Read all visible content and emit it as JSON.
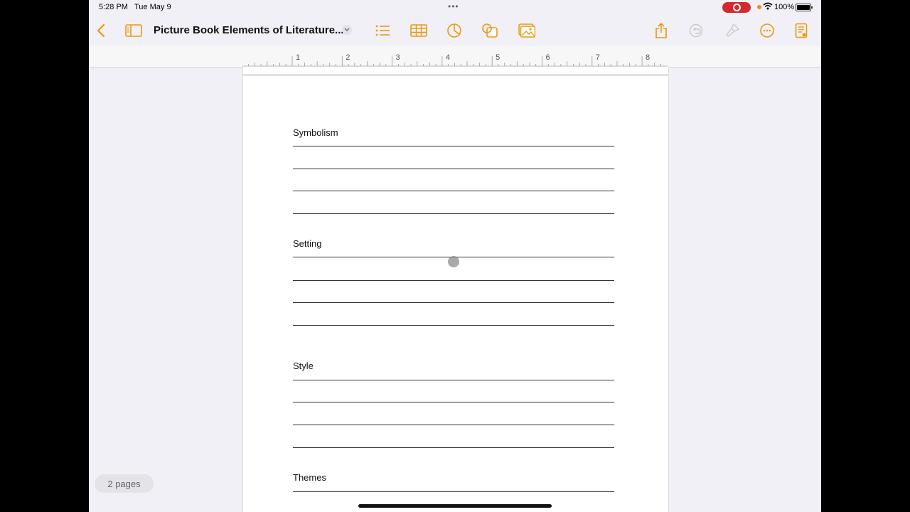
{
  "status_bar": {
    "time": "5:28 PM",
    "date": "Tue May 9",
    "battery": "100%"
  },
  "toolbar": {
    "document_title": "Picture Book Elements of Literature...",
    "accent_color": "#e89a10",
    "icons": [
      "back-chevron-icon",
      "sidebar-icon",
      "title-chevron-down-icon",
      "list-icon",
      "table-icon",
      "chart-icon",
      "shapes-icon",
      "media-icon",
      "share-icon",
      "undo-icon",
      "format-brush-icon",
      "more-icon",
      "document-setup-icon"
    ]
  },
  "ruler": {
    "labels": [
      "1",
      "2",
      "3",
      "4",
      "5",
      "6",
      "7",
      "8"
    ]
  },
  "document": {
    "sections": [
      {
        "label": "Symbolism"
      },
      {
        "label": "Setting"
      },
      {
        "label": "Style"
      },
      {
        "label": "Themes"
      }
    ]
  },
  "footer": {
    "page_count": "2 pages"
  }
}
